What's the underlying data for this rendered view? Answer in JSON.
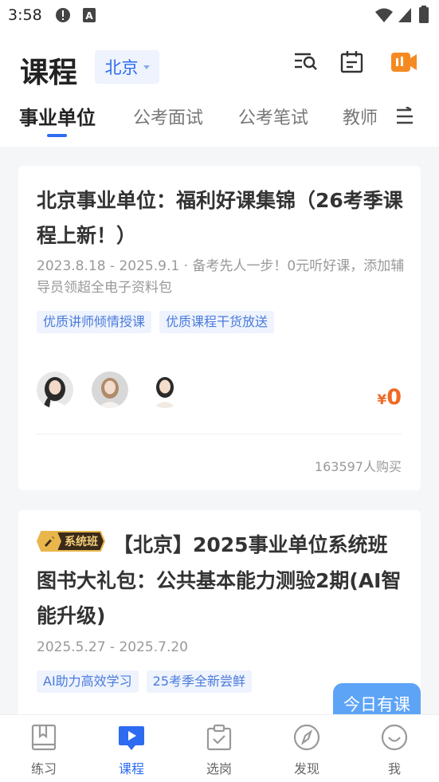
{
  "status_bar": {
    "time": "3:58"
  },
  "header": {
    "title": "课程",
    "city": "北京",
    "icons": [
      "search-list-icon",
      "calendar-icon",
      "video-icon"
    ]
  },
  "tabs": [
    {
      "label": "事业单位",
      "active": true
    },
    {
      "label": "公考面试",
      "active": false
    },
    {
      "label": "公考笔试",
      "active": false
    },
    {
      "label": "教师",
      "active": false
    }
  ],
  "courses": [
    {
      "title": "北京事业单位：福利好课集锦（26考季课程上新！）",
      "subtitle": "2023.8.18 - 2025.9.1 · 备考先人一步！0元听好课，添加辅导员领超全电子资料包",
      "tags": [
        "优质讲师倾情授课",
        "优质课程干货放送"
      ],
      "price_symbol": "¥",
      "price": "0",
      "buyers": "163597人购买"
    },
    {
      "badge": "系统班",
      "title": "【北京】2025事业单位系统班图书大礼包：公共基本能力测验2期(AI智能升级)",
      "subtitle": "2025.5.27 - 2025.7.20",
      "tags": [
        "AI助力高效学习",
        "25考季全新尝鲜"
      ]
    }
  ],
  "floating": {
    "today_label": "今日有课"
  },
  "bottom_nav": [
    {
      "label": "练习",
      "icon": "book-icon",
      "active": false
    },
    {
      "label": "课程",
      "icon": "play-icon",
      "active": true
    },
    {
      "label": "选岗",
      "icon": "clipboard-check-icon",
      "active": false
    },
    {
      "label": "发现",
      "icon": "compass-icon",
      "active": false
    },
    {
      "label": "我",
      "icon": "smile-icon",
      "active": false
    }
  ],
  "colors": {
    "accent": "#2d6cf0",
    "price": "#f06a25",
    "video_icon": "#f58a22"
  }
}
